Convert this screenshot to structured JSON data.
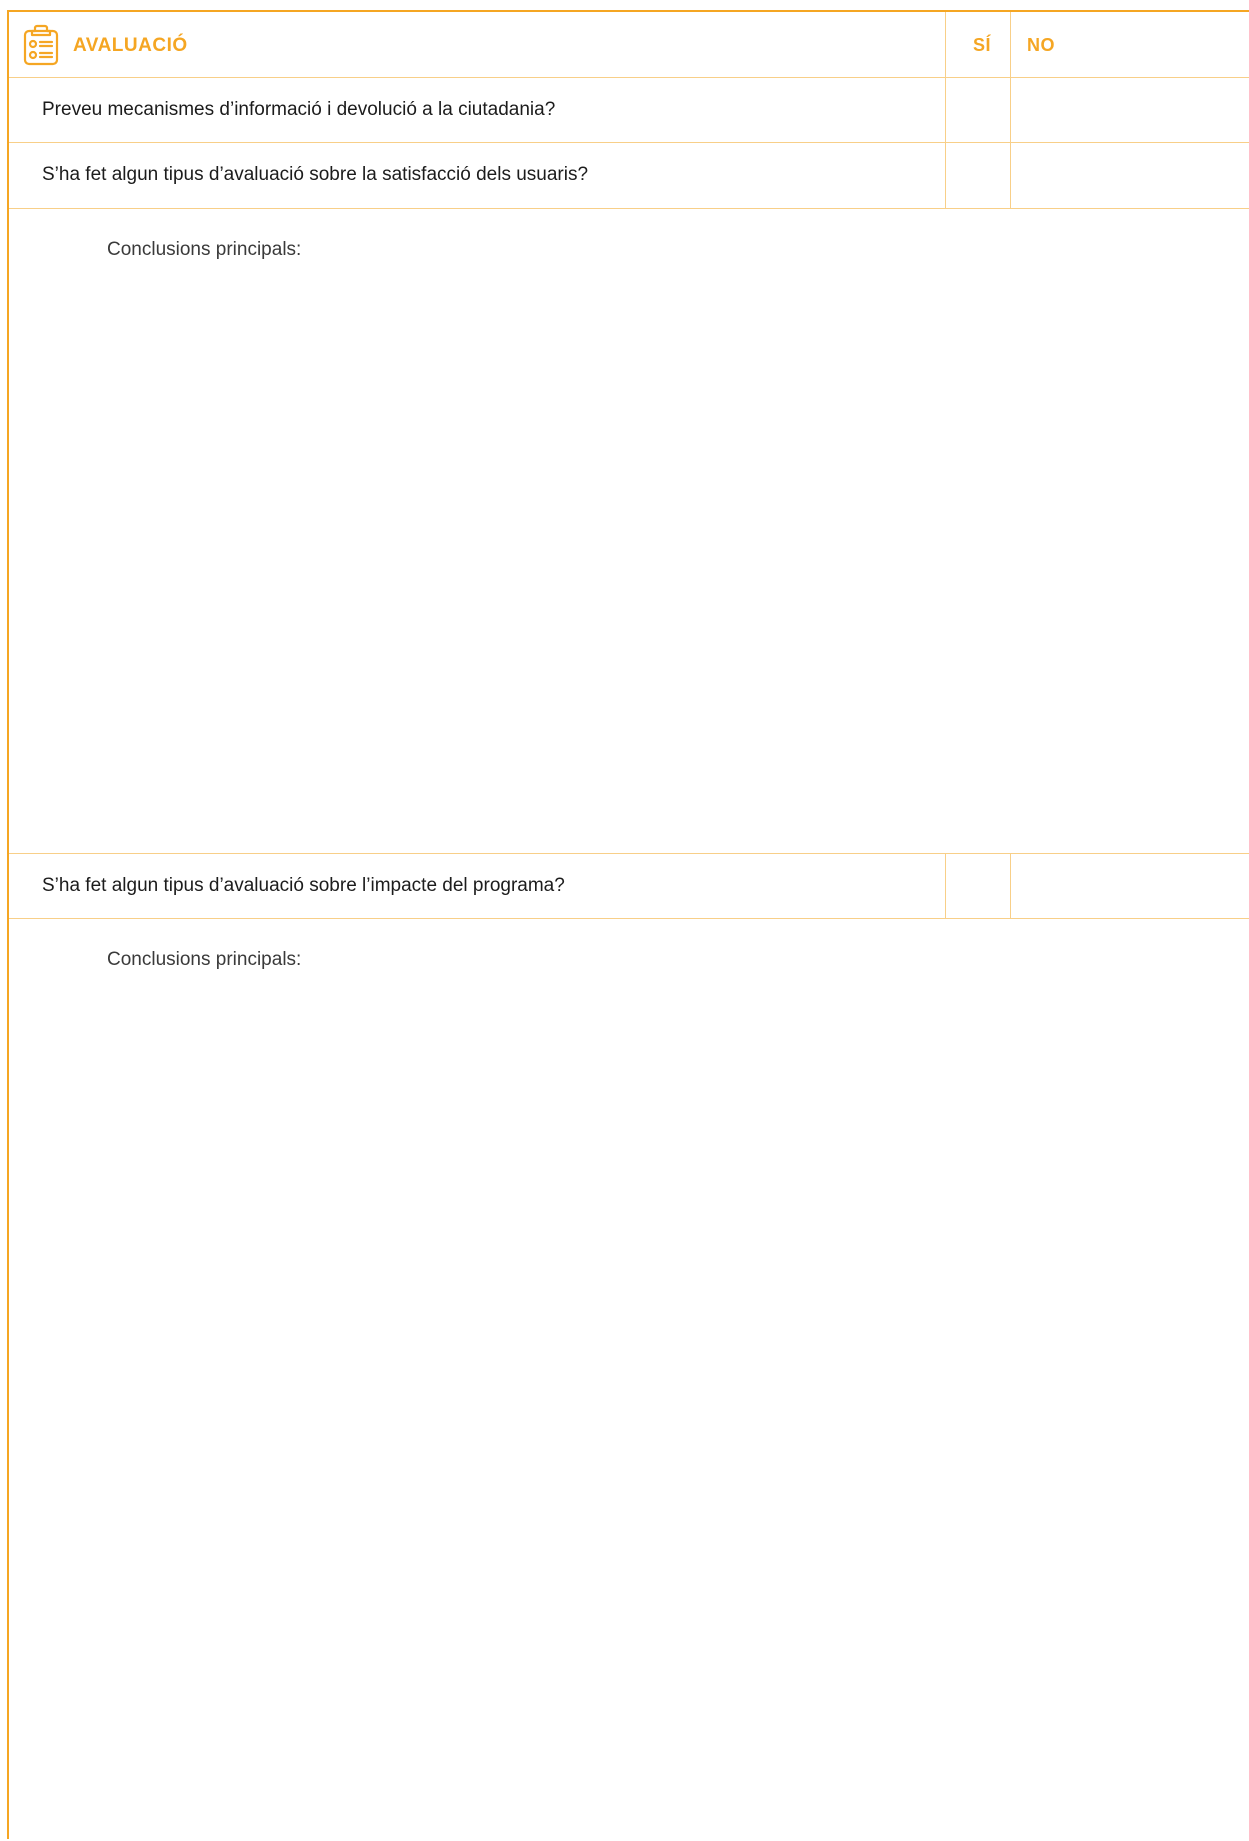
{
  "header": {
    "title": "AVALUACIÓ",
    "col_yes": "SÍ",
    "col_no": "NO"
  },
  "questions": [
    {
      "text": "Preveu mecanismes d’informació i devolució a la ciutadania?"
    },
    {
      "text": "S’ha fet algun tipus d’avaluació sobre la satisfacció dels usuaris?"
    },
    {
      "text": "S’ha fet algun tipus d’avaluació sobre l’impacte del programa?"
    }
  ],
  "conclusions": [
    {
      "label": "Conclusions principals:"
    },
    {
      "label": "Conclusions principals:"
    }
  ],
  "icons": {
    "header": "clipboard-checklist-icon"
  },
  "colors": {
    "accent": "#f5a623",
    "divider": "#f8cf88"
  }
}
